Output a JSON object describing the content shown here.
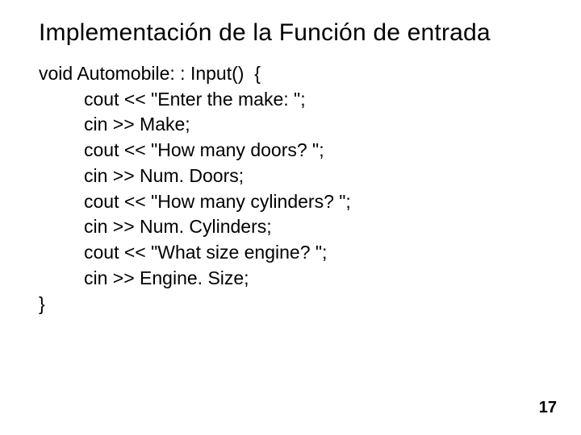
{
  "title": "Implementación de la Función de entrada",
  "code": {
    "l0": "void Automobile: : Input()  {",
    "l1": "cout << \"Enter the make: \";",
    "l2": "cin >> Make;",
    "l3": "cout << \"How many doors? \";",
    "l4": "cin >> Num. Doors;",
    "l5": "cout << \"How many cylinders? \";",
    "l6": "cin >> Num. Cylinders;",
    "l7": "cout << \"What size engine? \";",
    "l8": "cin >> Engine. Size;",
    "l9": "}"
  },
  "page_number": "17"
}
